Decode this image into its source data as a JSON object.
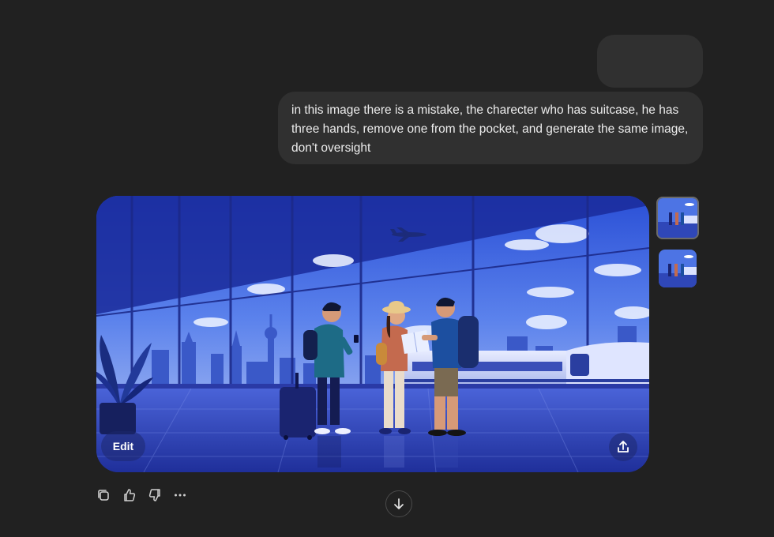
{
  "conversation": {
    "user_message": "in this image there is a mistake, the charecter who has suitcase, he has three hands, remove one from the pocket, and generate the same image, don't oversight"
  },
  "generated_image": {
    "edit_label": "Edit",
    "share_icon": "share-upload-icon",
    "thumbnails": [
      {
        "selected": true
      },
      {
        "selected": false
      }
    ]
  },
  "actions": {
    "copy_icon": "copy-icon",
    "like_icon": "thumbs-up-icon",
    "dislike_icon": "thumbs-down-icon",
    "more_icon": "more-dots-icon",
    "scroll_icon": "arrow-down-icon"
  },
  "colors": {
    "background": "#212121",
    "bubble": "#303030",
    "text": "#ececec",
    "icon": "#cfcfcf"
  }
}
